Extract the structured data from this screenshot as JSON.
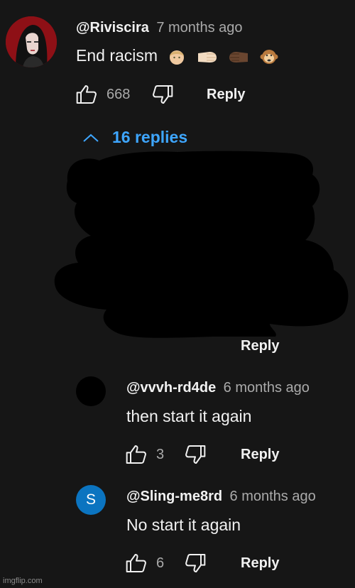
{
  "main_comment": {
    "handle": "@Riviscira",
    "time": "7 months ago",
    "text": "End racism",
    "emojis": [
      "light-skin-face-icon",
      "light-fist-icon",
      "dark-fist-icon",
      "monkey-face-icon"
    ],
    "likes": "668",
    "reply_label": "Reply"
  },
  "replies_toggle": {
    "label": "16 replies"
  },
  "hidden_reply": {
    "reply_label": "Reply"
  },
  "replies": [
    {
      "handle": "@vvvh-rd4de",
      "time": "6 months ago",
      "text": "then start it again",
      "likes": "3",
      "reply_label": "Reply"
    },
    {
      "avatar_letter": "S",
      "handle": "@Sling-me8rd",
      "time": "6 months ago",
      "text": "No start it again",
      "likes": "6",
      "reply_label": "Reply"
    }
  ],
  "watermark": "imgflip.com",
  "colors": {
    "background": "#161616",
    "link": "#3ea6ff",
    "avatar_s": "#0b74c0",
    "avatar_main": "#8e1016"
  }
}
